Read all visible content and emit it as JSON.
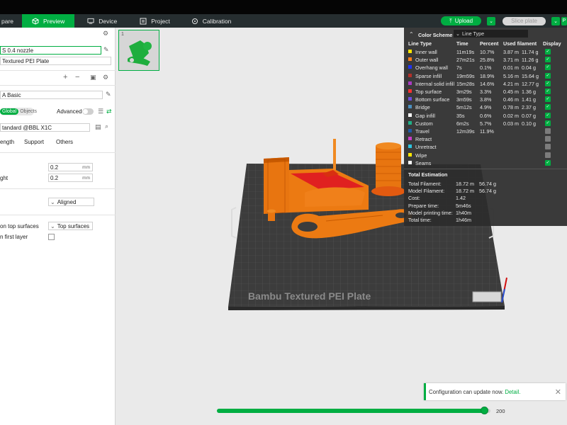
{
  "tabs": [
    {
      "label": "pare",
      "icon": "prepare-icon",
      "active": false
    },
    {
      "label": "Preview",
      "icon": "preview-cube-icon",
      "active": true
    },
    {
      "label": "Device",
      "icon": "device-icon",
      "active": false
    },
    {
      "label": "Project",
      "icon": "project-icon",
      "active": false
    },
    {
      "label": "Calibration",
      "icon": "calibration-icon",
      "active": false
    }
  ],
  "toolbar": {
    "upload_label": "Upload",
    "slice_label": "Slice plate",
    "edge_label": "P"
  },
  "sidebar": {
    "nozzle": "S 0.4 nozzle",
    "plate": "Textured PEI Plate",
    "filament": "A Basic",
    "global_label": "Global",
    "objects_label": "Objects",
    "advanced_label": "Advanced",
    "process": "tandard @BBL X1C",
    "tabs": [
      "ength",
      "Support",
      "Others"
    ],
    "params": [
      {
        "label": "",
        "value": "0.2",
        "unit": "mm"
      },
      {
        "label": "ght",
        "value": "0.2",
        "unit": "mm"
      }
    ],
    "seam_value": "Aligned",
    "ironing_label": "on top surfaces",
    "ironing_value": "Top surfaces",
    "first_layer_label": "n first layer"
  },
  "plate_label": "Bambu Textured PEI Plate",
  "plate_number": "1",
  "color_scheme": {
    "title": "Color Scheme",
    "selected": "Line Type",
    "headers": [
      "Line Type",
      "Time",
      "Percent",
      "Used filament",
      "Display"
    ],
    "rows": [
      {
        "name": "Inner wall",
        "color": "#ffe600",
        "time": "11m19s",
        "percent": "10.7%",
        "length": "3.87 m",
        "weight": "11.74 g",
        "display": true
      },
      {
        "name": "Outer wall",
        "color": "#ff7d1a",
        "time": "27m21s",
        "percent": "25.8%",
        "length": "3.71 m",
        "weight": "11.26 g",
        "display": true
      },
      {
        "name": "Overhang wall",
        "color": "#1e32ff",
        "time": "7s",
        "percent": "0.1%",
        "length": "0.01 m",
        "weight": "0.04 g",
        "display": true
      },
      {
        "name": "Sparse infill",
        "color": "#b4302a",
        "time": "19m59s",
        "percent": "18.9%",
        "length": "5.16 m",
        "weight": "15.64 g",
        "display": true
      },
      {
        "name": "Internal solid infill",
        "color": "#a83ac2",
        "time": "15m28s",
        "percent": "14.6%",
        "length": "4.21 m",
        "weight": "12.77 g",
        "display": true
      },
      {
        "name": "Top surface",
        "color": "#ff3030",
        "time": "3m29s",
        "percent": "3.3%",
        "length": "0.45 m",
        "weight": "1.36 g",
        "display": true
      },
      {
        "name": "Bottom surface",
        "color": "#6c4cdc",
        "time": "3m59s",
        "percent": "3.8%",
        "length": "0.46 m",
        "weight": "1.41 g",
        "display": true
      },
      {
        "name": "Bridge",
        "color": "#4a8fc0",
        "time": "5m12s",
        "percent": "4.9%",
        "length": "0.78 m",
        "weight": "2.37 g",
        "display": true
      },
      {
        "name": "Gap infill",
        "color": "#ffffff",
        "time": "35s",
        "percent": "0.6%",
        "length": "0.02 m",
        "weight": "0.07 g",
        "display": true
      },
      {
        "name": "Custom",
        "color": "#1fb088",
        "time": "6m2s",
        "percent": "5.7%",
        "length": "0.03 m",
        "weight": "0.10 g",
        "display": true
      },
      {
        "name": "Travel",
        "color": "#1f5aa8",
        "time": "12m39s",
        "percent": "11.9%",
        "length": "",
        "weight": "",
        "display": false
      },
      {
        "name": "Retract",
        "color": "#c83cc8",
        "time": "",
        "percent": "",
        "length": "",
        "weight": "",
        "display": false
      },
      {
        "name": "Unretract",
        "color": "#2cc4e0",
        "time": "",
        "percent": "",
        "length": "",
        "weight": "",
        "display": false
      },
      {
        "name": "Wipe",
        "color": "#ffe600",
        "time": "",
        "percent": "",
        "length": "",
        "weight": "",
        "display": false
      },
      {
        "name": "Seams",
        "color": "#ffffff",
        "time": "",
        "percent": "",
        "length": "",
        "weight": "",
        "display": true
      }
    ],
    "estimation_title": "Total Estimation",
    "estimation": [
      {
        "label": "Total Filament:",
        "value": "18.72 m",
        "extra": "56.74 g"
      },
      {
        "label": "Model Filament:",
        "value": "18.72 m",
        "extra": "56.74 g"
      },
      {
        "label": "Cost:",
        "value": "1.42",
        "extra": ""
      },
      {
        "label": "Prepare time:",
        "value": "5m46s",
        "extra": ""
      },
      {
        "label": "Model printing time:",
        "value": "1h40m",
        "extra": ""
      },
      {
        "label": "Total time:",
        "value": "1h46m",
        "extra": ""
      }
    ]
  },
  "toast": {
    "message": "Configuration can update now.",
    "link": "Detail."
  },
  "layer_slider": {
    "value": 200,
    "max": 200,
    "fraction": 0.98
  }
}
